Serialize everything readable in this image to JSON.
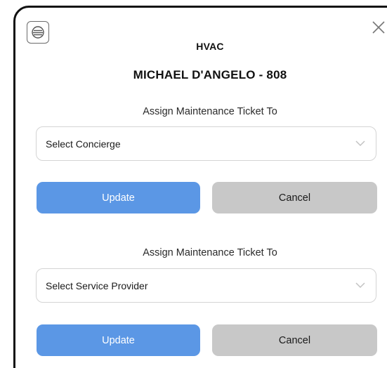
{
  "modal": {
    "title": "HVAC",
    "resident": "MICHAEL D'ANGELO - 808"
  },
  "concierge_section": {
    "label": "Assign Maintenance Ticket To",
    "select_value": "Select Concierge",
    "update_label": "Update",
    "cancel_label": "Cancel"
  },
  "provider_section": {
    "label": "Assign Maintenance Ticket To",
    "select_value": "Select Service Provider",
    "update_label": "Update",
    "cancel_label": "Cancel"
  },
  "icons": {
    "menu": "list-icon",
    "close": "close-icon",
    "dropdown": "chevron-down-icon"
  },
  "colors": {
    "update_button": "#5b97e5",
    "cancel_button": "#c8c8c8",
    "modal_border": "#111111"
  }
}
